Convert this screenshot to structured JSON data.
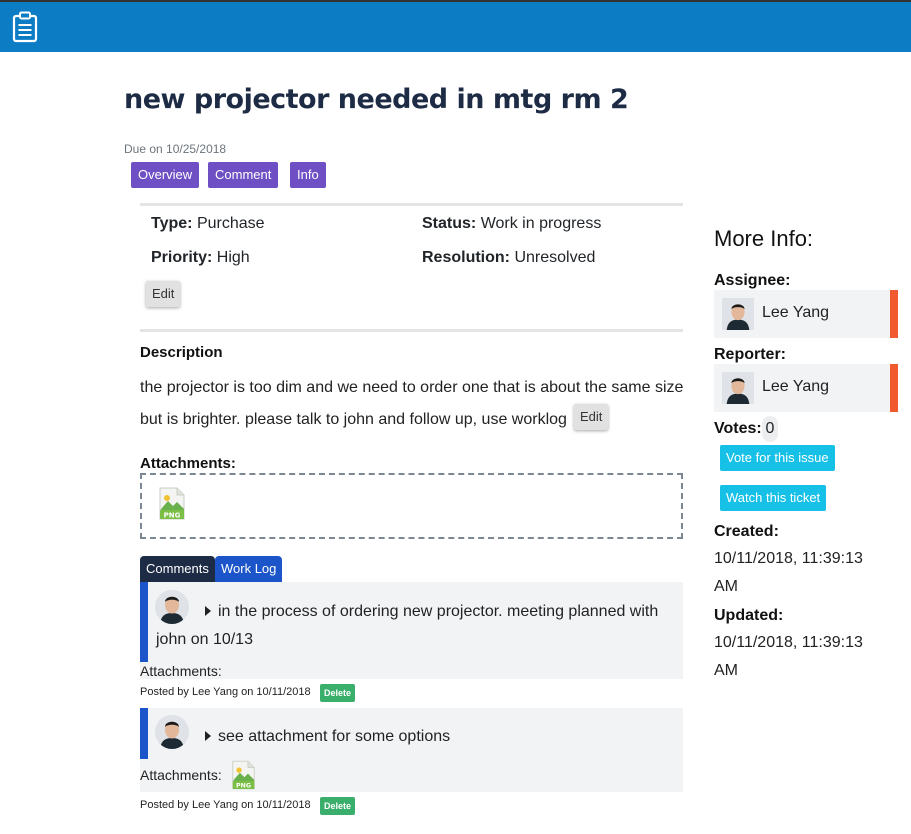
{
  "header": {
    "icon": "clipboard-icon"
  },
  "issue": {
    "title": "new projector needed in mtg rm 2",
    "due": "Due on 10/25/2018"
  },
  "tabs": [
    "Overview",
    "Comment",
    "Info"
  ],
  "fields": {
    "type_label": "Type:",
    "type_value": "Purchase",
    "status_label": "Status:",
    "status_value": "Work in progress",
    "priority_label": "Priority:",
    "priority_value": "High",
    "resolution_label": "Resolution:",
    "resolution_value": "Unresolved",
    "edit_label": "Edit"
  },
  "description": {
    "label": "Description",
    "text": "the projector is too dim and we need to order one that is about the same size but is brighter. please talk to john and follow up, use worklog",
    "edit_label": "Edit"
  },
  "attachments": {
    "label": "Attachments:",
    "file_icon": "png-file-icon",
    "file_type": "PNG"
  },
  "comment_tabs": [
    "Comments",
    "Work Log"
  ],
  "comments": [
    {
      "text": "in the process of ordering new projector. meeting planned with john on 10/13",
      "attachments_label": "Attachments:",
      "posted": "Posted by Lee Yang on 10/11/2018",
      "delete_label": "Delete"
    },
    {
      "text": "see attachment for some options",
      "attachments_label": "Attachments:",
      "posted": "Posted by Lee Yang on 10/11/2018",
      "delete_label": "Delete"
    }
  ],
  "sidebar": {
    "title": "More Info:",
    "assignee_label": "Assignee:",
    "assignee_name": "Lee Yang",
    "reporter_label": "Reporter:",
    "reporter_name": "Lee Yang",
    "votes_label": "Votes:",
    "votes_count": "0",
    "vote_button": "Vote for this issue",
    "watch_button": "Watch this ticket",
    "created_label": "Created:",
    "created_value": "10/11/2018, 11:39:13 AM",
    "updated_label": "Updated:",
    "updated_value": "10/11/2018, 11:39:13 AM"
  },
  "colors": {
    "header": "#0c7cc4",
    "tab_purple": "#6f4fc4",
    "cyan_button": "#17c0e6",
    "delete_green": "#3aaf6b",
    "person_stripe": "#f15a2e",
    "comment_bar": "#1b55c9"
  }
}
